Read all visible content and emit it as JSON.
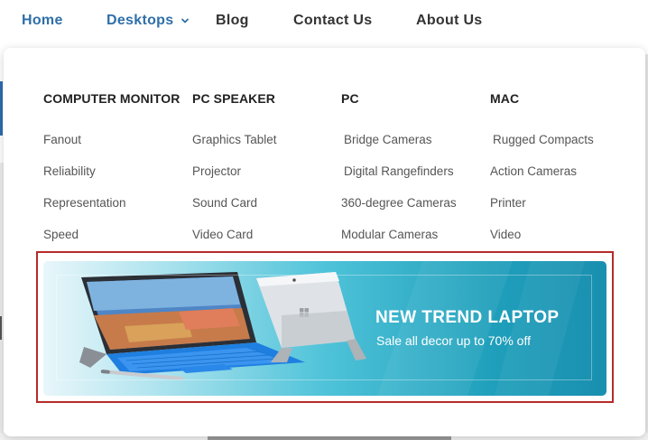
{
  "nav": {
    "items": [
      {
        "label": "Home",
        "active": true
      },
      {
        "label": "Desktops",
        "active": true,
        "has_dropdown": true
      },
      {
        "label": "Blog"
      },
      {
        "label": "Contact Us"
      },
      {
        "label": "About Us"
      }
    ],
    "dropdown_icon": "chevron-down-icon"
  },
  "mega_menu": {
    "columns": [
      {
        "heading": "COMPUTER MONITOR",
        "items": [
          "Fanout",
          "Reliability",
          "Representation",
          "Speed"
        ]
      },
      {
        "heading": "PC SPEAKER",
        "items": [
          "Graphics Tablet",
          "Projector",
          "Sound Card",
          "Video Card"
        ]
      },
      {
        "heading": "PC",
        "items": [
          "Bridge Cameras",
          "Digital Rangefinders",
          "360-degree Cameras",
          "Modular Cameras"
        ]
      },
      {
        "heading": "MAC",
        "items": [
          "Rugged Compacts",
          "Action Cameras",
          "Printer",
          "Video"
        ]
      }
    ],
    "banner": {
      "title": "NEW TREND LAPTOP",
      "subtitle": "Sale all decor up to 70% off"
    }
  },
  "colors": {
    "nav_active": "#2f6fa8",
    "banner_gradient_end": "#1a8fb0",
    "highlight_outline": "#b72a2a"
  }
}
